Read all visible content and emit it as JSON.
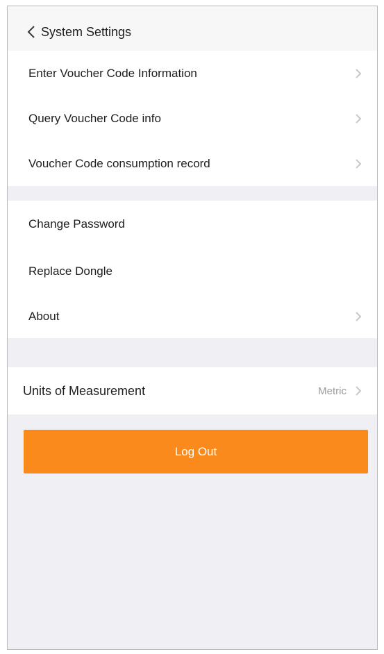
{
  "header": {
    "back_label": "System Settings"
  },
  "groups": [
    {
      "items": [
        {
          "label": "Enter Voucher Code Information",
          "chevron": true
        },
        {
          "label": "Query Voucher Code info",
          "chevron": true
        },
        {
          "label": "Voucher Code consumption record",
          "chevron": true
        }
      ]
    },
    {
      "items": [
        {
          "label": "Change Password",
          "chevron": false
        },
        {
          "label": "Replace Dongle",
          "chevron": false
        },
        {
          "label": "About",
          "chevron": true
        }
      ]
    },
    {
      "items": [
        {
          "label": "Units of Measurement",
          "value": "Metric",
          "chevron": true
        }
      ]
    }
  ],
  "logout": {
    "label": "Log Out"
  },
  "colors": {
    "accent": "#fb8a1d",
    "background": "#efeff4",
    "row_background": "#ffffff"
  }
}
